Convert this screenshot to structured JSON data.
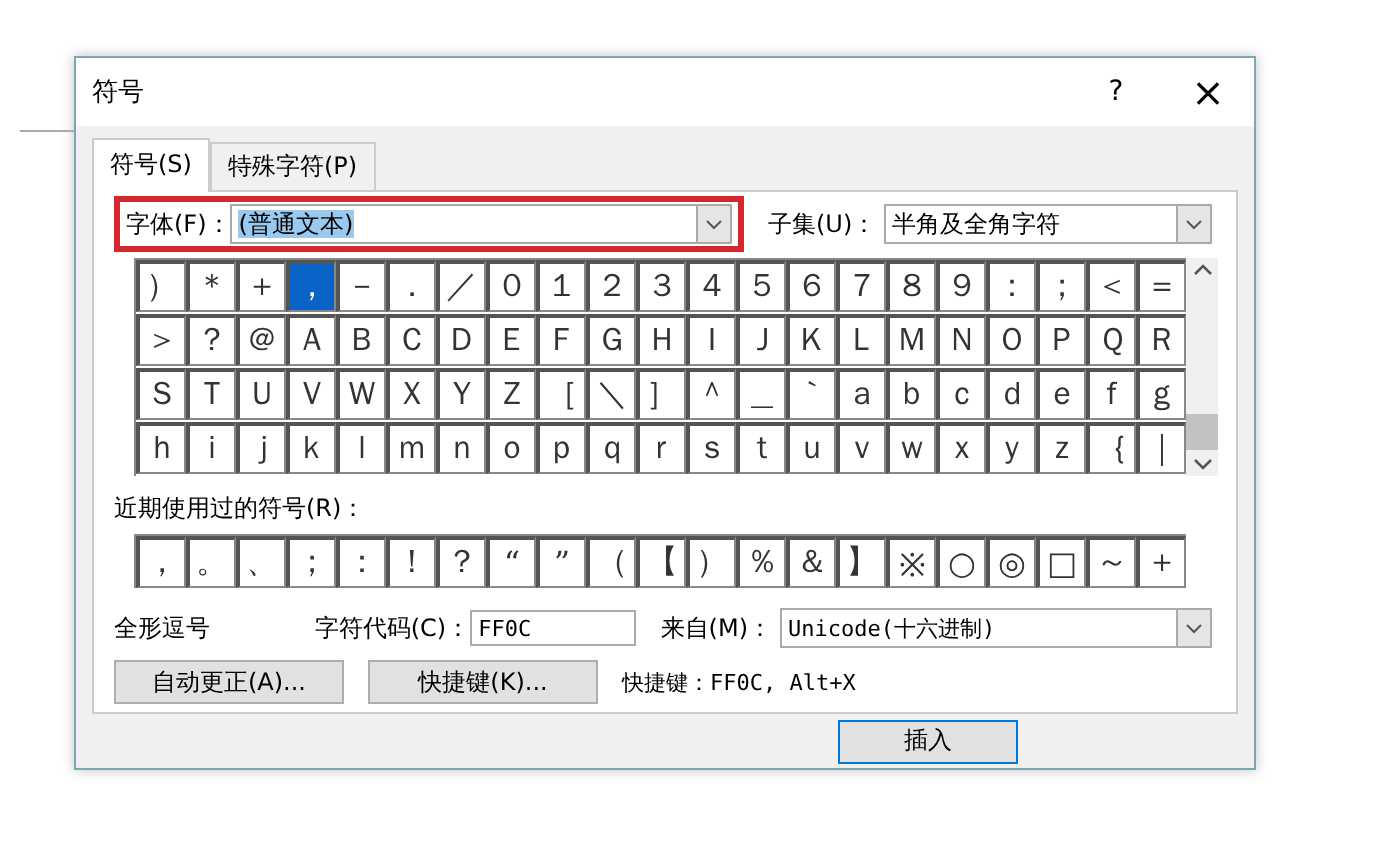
{
  "window": {
    "title": "符号",
    "help": "?",
    "close": "×"
  },
  "tabs": [
    {
      "label": "符号(S)",
      "selected": true
    },
    {
      "label": "特殊字符(P)",
      "selected": false
    }
  ],
  "font": {
    "label": "字体(F)：",
    "value": "(普通文本)"
  },
  "subset": {
    "label": "子集(U)：",
    "value": "半角及全角字符"
  },
  "symbols": [
    [
      {
        "char": "）",
        "selected": false
      },
      {
        "char": "＊",
        "selected": false
      },
      {
        "char": "＋",
        "selected": false
      },
      {
        "char": "，",
        "selected": true
      },
      {
        "char": "－",
        "selected": false
      },
      {
        "char": "．",
        "selected": false
      },
      {
        "char": "／",
        "selected": false
      },
      {
        "char": "０",
        "selected": false
      },
      {
        "char": "１",
        "selected": false
      },
      {
        "char": "２",
        "selected": false
      },
      {
        "char": "３",
        "selected": false
      },
      {
        "char": "４",
        "selected": false
      },
      {
        "char": "５",
        "selected": false
      },
      {
        "char": "６",
        "selected": false
      },
      {
        "char": "７",
        "selected": false
      },
      {
        "char": "８",
        "selected": false
      },
      {
        "char": "９",
        "selected": false
      },
      {
        "char": "：",
        "selected": false
      },
      {
        "char": "；",
        "selected": false
      },
      {
        "char": "＜",
        "selected": false
      },
      {
        "char": "＝",
        "selected": false
      }
    ],
    [
      {
        "char": "＞",
        "selected": false
      },
      {
        "char": "？",
        "selected": false
      },
      {
        "char": "＠",
        "selected": false
      },
      {
        "char": "Ａ",
        "selected": false
      },
      {
        "char": "Ｂ",
        "selected": false
      },
      {
        "char": "Ｃ",
        "selected": false
      },
      {
        "char": "Ｄ",
        "selected": false
      },
      {
        "char": "Ｅ",
        "selected": false
      },
      {
        "char": "Ｆ",
        "selected": false
      },
      {
        "char": "Ｇ",
        "selected": false
      },
      {
        "char": "Ｈ",
        "selected": false
      },
      {
        "char": "Ｉ",
        "selected": false
      },
      {
        "char": "Ｊ",
        "selected": false
      },
      {
        "char": "Ｋ",
        "selected": false
      },
      {
        "char": "Ｌ",
        "selected": false
      },
      {
        "char": "Ｍ",
        "selected": false
      },
      {
        "char": "Ｎ",
        "selected": false
      },
      {
        "char": "Ｏ",
        "selected": false
      },
      {
        "char": "Ｐ",
        "selected": false
      },
      {
        "char": "Ｑ",
        "selected": false
      },
      {
        "char": "Ｒ",
        "selected": false
      }
    ],
    [
      {
        "char": "Ｓ",
        "selected": false
      },
      {
        "char": "Ｔ",
        "selected": false
      },
      {
        "char": "Ｕ",
        "selected": false
      },
      {
        "char": "Ｖ",
        "selected": false
      },
      {
        "char": "Ｗ",
        "selected": false
      },
      {
        "char": "Ｘ",
        "selected": false
      },
      {
        "char": "Ｙ",
        "selected": false
      },
      {
        "char": "Ｚ",
        "selected": false
      },
      {
        "char": "［",
        "selected": false
      },
      {
        "char": "＼",
        "selected": false
      },
      {
        "char": "］",
        "selected": false
      },
      {
        "char": "＾",
        "selected": false
      },
      {
        "char": "＿",
        "selected": false
      },
      {
        "char": "｀",
        "selected": false
      },
      {
        "char": "ａ",
        "selected": false
      },
      {
        "char": "ｂ",
        "selected": false
      },
      {
        "char": "ｃ",
        "selected": false
      },
      {
        "char": "ｄ",
        "selected": false
      },
      {
        "char": "ｅ",
        "selected": false
      },
      {
        "char": "ｆ",
        "selected": false
      },
      {
        "char": "ｇ",
        "selected": false
      }
    ],
    [
      {
        "char": "ｈ",
        "selected": false
      },
      {
        "char": "ｉ",
        "selected": false
      },
      {
        "char": "ｊ",
        "selected": false
      },
      {
        "char": "ｋ",
        "selected": false
      },
      {
        "char": "ｌ",
        "selected": false
      },
      {
        "char": "ｍ",
        "selected": false
      },
      {
        "char": "ｎ",
        "selected": false
      },
      {
        "char": "ｏ",
        "selected": false
      },
      {
        "char": "ｐ",
        "selected": false
      },
      {
        "char": "ｑ",
        "selected": false
      },
      {
        "char": "ｒ",
        "selected": false
      },
      {
        "char": "ｓ",
        "selected": false
      },
      {
        "char": "ｔ",
        "selected": false
      },
      {
        "char": "ｕ",
        "selected": false
      },
      {
        "char": "ｖ",
        "selected": false
      },
      {
        "char": "ｗ",
        "selected": false
      },
      {
        "char": "ｘ",
        "selected": false
      },
      {
        "char": "ｙ",
        "selected": false
      },
      {
        "char": "ｚ",
        "selected": false
      },
      {
        "char": "｛",
        "selected": false
      },
      {
        "char": "｜",
        "selected": false
      }
    ]
  ],
  "recent": {
    "label": "近期使用过的符号(R)：",
    "symbols": [
      "，",
      "。",
      "、",
      "；",
      "：",
      "！",
      "？",
      "“",
      "”",
      "（",
      "【",
      "）",
      "％",
      "＆",
      "】",
      "※",
      "○",
      "◎",
      "□",
      "～",
      "＋"
    ]
  },
  "char_name": "全形逗号",
  "code": {
    "label": "字符代码(C)：",
    "value": "FF0C"
  },
  "from": {
    "label": "来自(M)：",
    "value": "Unicode(十六进制)"
  },
  "buttons": [
    {
      "label": "自动更正(A)..."
    },
    {
      "label": "快捷键(K)..."
    }
  ],
  "shortcut": "快捷键：FF0C, Alt+X",
  "insert_button": "插入"
}
